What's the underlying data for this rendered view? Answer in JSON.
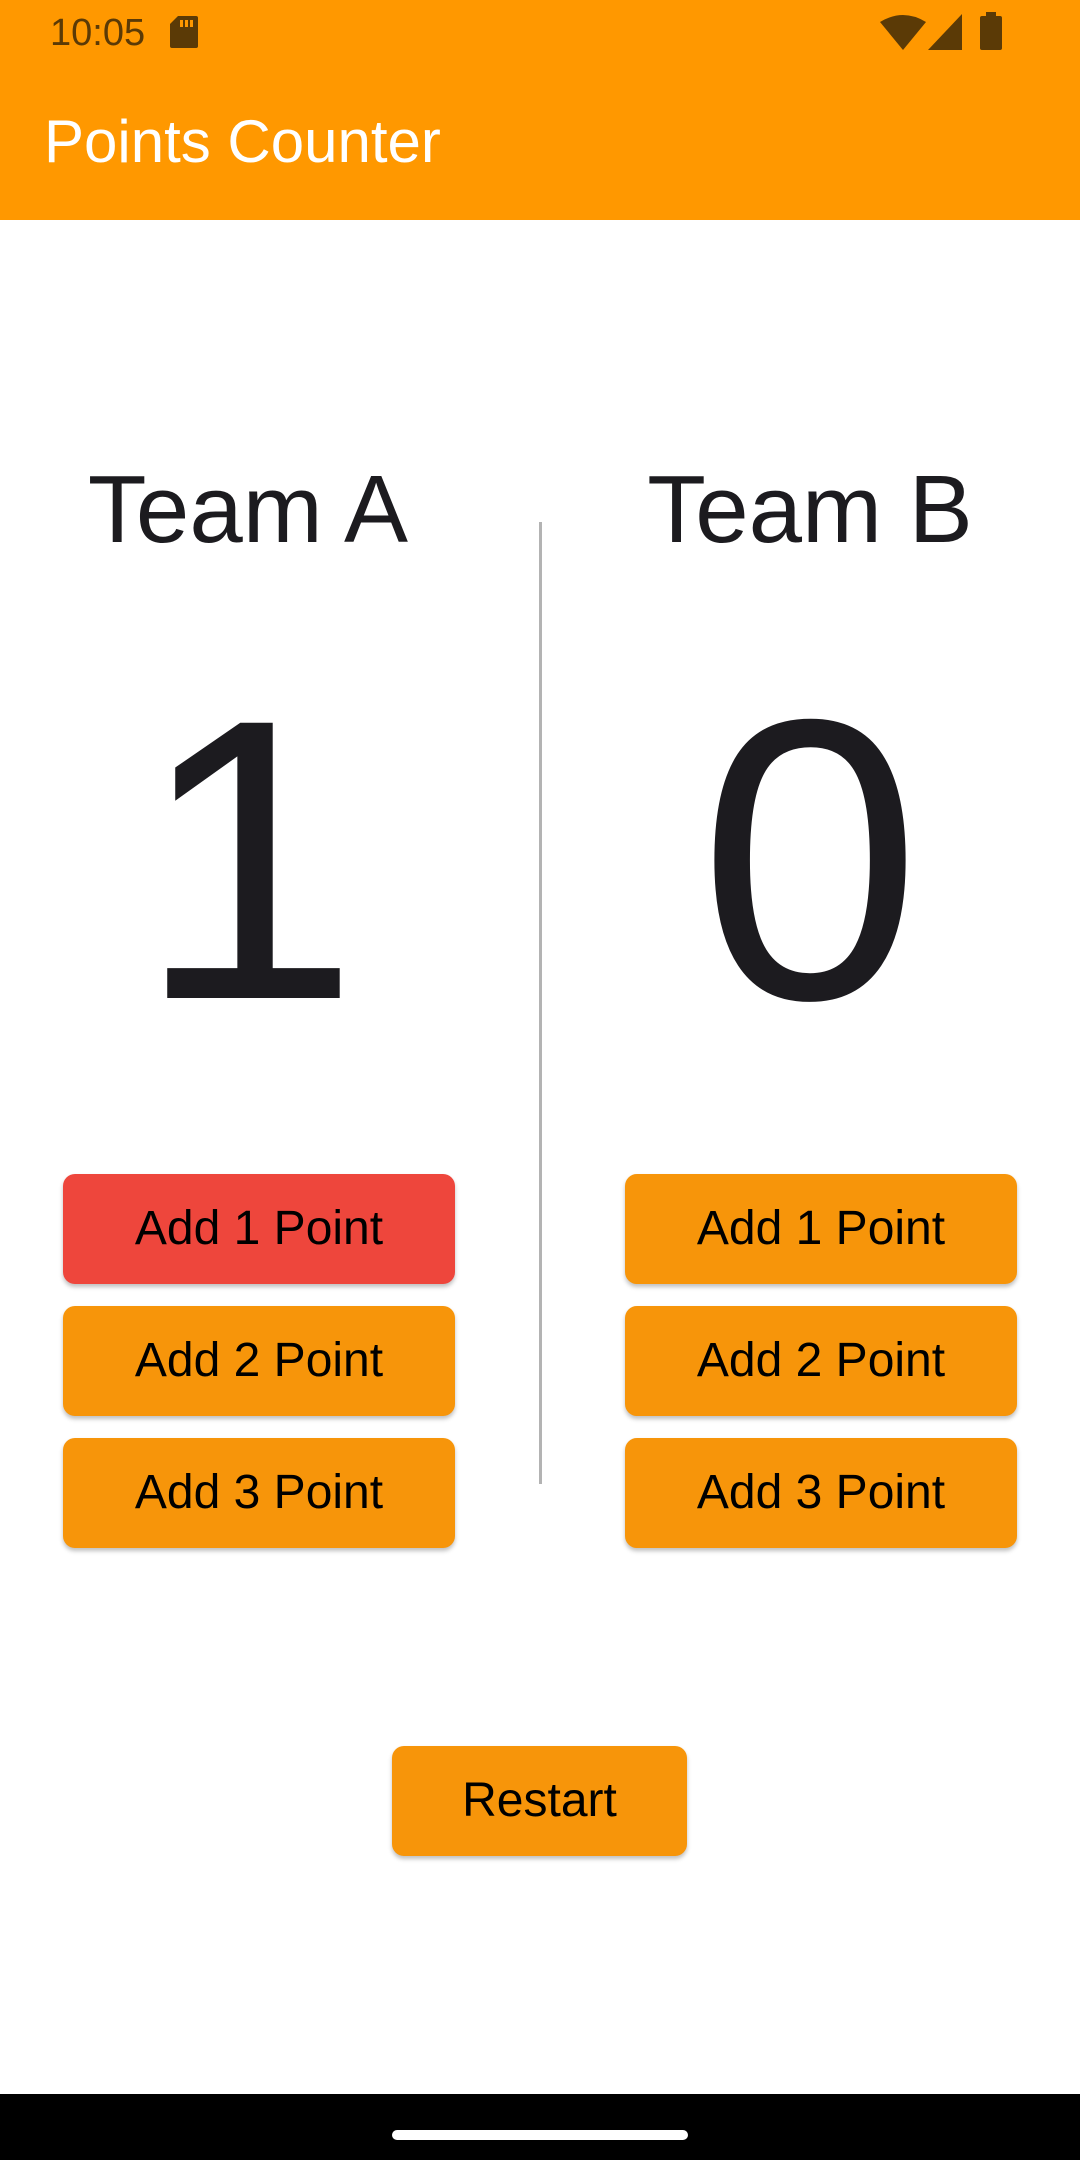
{
  "status_bar": {
    "time": "10:05"
  },
  "app_bar": {
    "title": "Points Counter"
  },
  "team_a": {
    "name": "Team A",
    "score": "1",
    "buttons": [
      "Add 1 Point",
      "Add 2 Point",
      "Add 3 Point"
    ]
  },
  "team_b": {
    "name": "Team B",
    "score": "0",
    "buttons": [
      "Add 1 Point",
      "Add 2 Point",
      "Add 3 Point"
    ]
  },
  "restart_label": "Restart",
  "colors": {
    "accent": "#ff9800",
    "button": "#f7950a",
    "button_pressed": "#ee463c"
  }
}
